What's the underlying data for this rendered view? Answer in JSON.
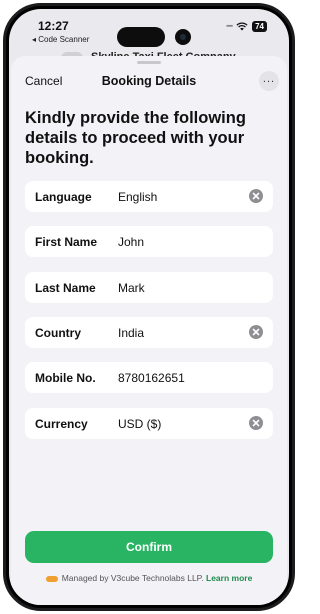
{
  "status_bar": {
    "time": "12:27",
    "back_app": "◂ Code Scanner",
    "battery": "74"
  },
  "background": {
    "title": "Skyline Taxi Fleet Company"
  },
  "sheet": {
    "cancel_label": "Cancel",
    "title": "Booking Details",
    "more_label": "..."
  },
  "heading": "Kindly provide the following details to proceed with your booking.",
  "fields": [
    {
      "label": "Language",
      "value": "English",
      "clearable": true
    },
    {
      "label": "First Name",
      "value": "John",
      "clearable": false
    },
    {
      "label": "Last Name",
      "value": "Mark",
      "clearable": false
    },
    {
      "label": "Country",
      "value": "India",
      "clearable": true
    },
    {
      "label": "Mobile No.",
      "value": "8780162651",
      "clearable": false
    },
    {
      "label": "Currency",
      "value": "USD ($)",
      "clearable": true
    }
  ],
  "confirm_label": "Confirm",
  "footer": {
    "text": "Managed by V3cube Technolabs LLP.",
    "link": "Learn more"
  },
  "colors": {
    "accent": "#28b463",
    "link": "#1f8a4c"
  }
}
